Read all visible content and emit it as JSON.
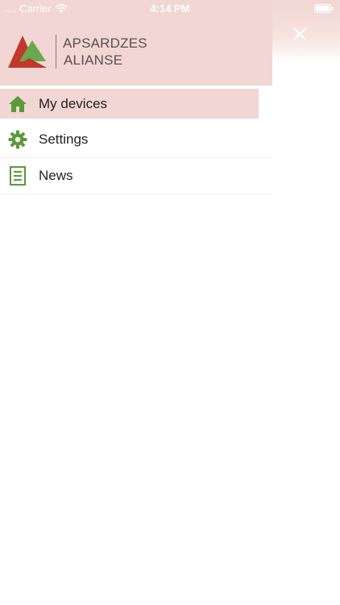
{
  "status_bar": {
    "carrier": ".... Carrier",
    "time": "4:14 PM"
  },
  "header": {
    "logo_line1": "APSARDZES",
    "logo_line2": "ALIANSE"
  },
  "menu": {
    "items": [
      {
        "label": "My devices",
        "icon": "home-icon",
        "active": true
      },
      {
        "label": "Settings",
        "icon": "gear-icon",
        "active": false
      },
      {
        "label": "News",
        "icon": "news-icon",
        "active": false
      }
    ]
  },
  "colors": {
    "header_bg": "#f1d6d3",
    "active_bg": "#f1d6d3",
    "icon_green": "#5b9a3a",
    "logo_red": "#c0392b",
    "logo_green": "#6aa84f"
  }
}
